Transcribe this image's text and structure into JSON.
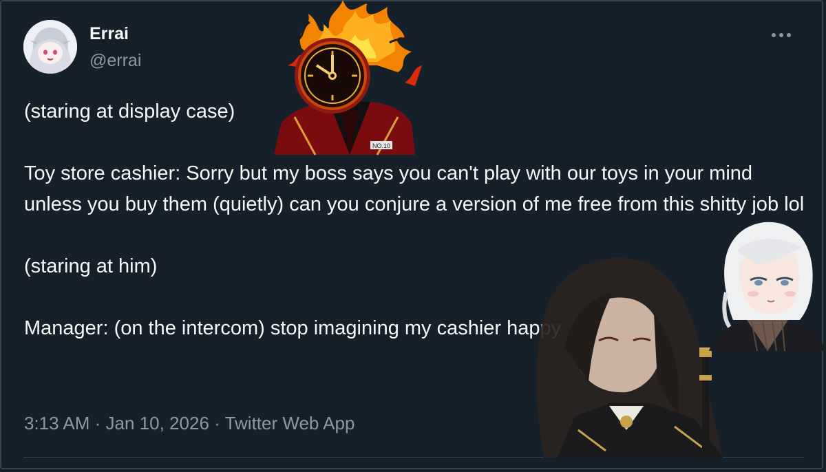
{
  "tweet": {
    "author": {
      "display_name": "Errai",
      "handle": "@errai"
    },
    "body_lines": [
      "(staring at display case)",
      "",
      "Toy store cashier: Sorry but my boss says you can't play with our toys in your mind unless you buy them (quietly) can you conjure a version of me free from this shitty job lol",
      "",
      "(staring at him)",
      "",
      "Manager: (on the intercom) stop imagining my cashier happy"
    ],
    "time": "3:13 AM",
    "separator": "·",
    "date": "Jan 10, 2026",
    "source": "Twitter Web App",
    "more_icon": "more-horizontal-icon"
  },
  "stickers": {
    "clock_head_badge": "NO.10",
    "clock_head_icon": "flaming-clock-head-character",
    "long_hair_icon": "long-haired-character",
    "white_hair_icon": "white-haired-character"
  },
  "colors": {
    "background": "#15202b",
    "text_primary": "#f7f9f9",
    "text_secondary": "#8b98a5",
    "border": "#38444d"
  }
}
